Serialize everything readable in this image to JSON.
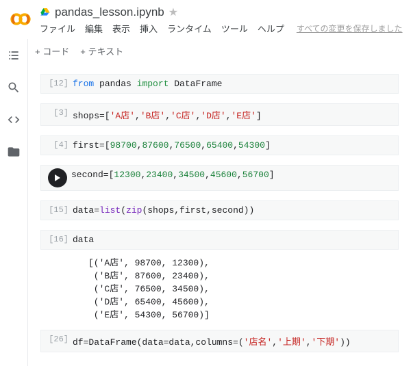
{
  "header": {
    "filename": "pandas_lesson.ipynb",
    "menus": [
      "ファイル",
      "編集",
      "表示",
      "挿入",
      "ランタイム",
      "ツール",
      "ヘルプ"
    ],
    "save_status": "すべての変更を保存しました"
  },
  "toolbar": {
    "code": "コード",
    "text": "テキスト"
  },
  "cells": [
    {
      "n": "[12]",
      "tokens": [
        {
          "t": "from",
          "c": "kw1"
        },
        {
          "t": " pandas ",
          "c": ""
        },
        {
          "t": "import",
          "c": "kw2"
        },
        {
          "t": " DataFrame",
          "c": ""
        }
      ]
    },
    {
      "n": "[3]",
      "tokens": [
        {
          "t": "shops=[",
          "c": ""
        },
        {
          "t": "'A店'",
          "c": "str"
        },
        {
          "t": ",",
          "c": ""
        },
        {
          "t": "'B店'",
          "c": "str"
        },
        {
          "t": ",",
          "c": ""
        },
        {
          "t": "'C店'",
          "c": "str"
        },
        {
          "t": ",",
          "c": ""
        },
        {
          "t": "'D店'",
          "c": "str"
        },
        {
          "t": ",",
          "c": ""
        },
        {
          "t": "'E店'",
          "c": "str"
        },
        {
          "t": "]",
          "c": ""
        }
      ]
    },
    {
      "n": "[4]",
      "tokens": [
        {
          "t": "first=[",
          "c": ""
        },
        {
          "t": "98700",
          "c": "num"
        },
        {
          "t": ",",
          "c": ""
        },
        {
          "t": "87600",
          "c": "num"
        },
        {
          "t": ",",
          "c": ""
        },
        {
          "t": "76500",
          "c": "num"
        },
        {
          "t": ",",
          "c": ""
        },
        {
          "t": "65400",
          "c": "num"
        },
        {
          "t": ",",
          "c": ""
        },
        {
          "t": "54300",
          "c": "num"
        },
        {
          "t": "]",
          "c": ""
        }
      ]
    },
    {
      "n": "",
      "active": true,
      "tokens": [
        {
          "t": "second=[",
          "c": ""
        },
        {
          "t": "12300",
          "c": "num"
        },
        {
          "t": ",",
          "c": ""
        },
        {
          "t": "23400",
          "c": "num"
        },
        {
          "t": ",",
          "c": ""
        },
        {
          "t": "34500",
          "c": "num"
        },
        {
          "t": ",",
          "c": ""
        },
        {
          "t": "45600",
          "c": "num"
        },
        {
          "t": ",",
          "c": ""
        },
        {
          "t": "56700",
          "c": "num"
        },
        {
          "t": "]",
          "c": ""
        }
      ]
    },
    {
      "n": "[15]",
      "tokens": [
        {
          "t": "data=",
          "c": ""
        },
        {
          "t": "list",
          "c": "fn"
        },
        {
          "t": "(",
          "c": ""
        },
        {
          "t": "zip",
          "c": "fn"
        },
        {
          "t": "(shops,first,second))",
          "c": ""
        }
      ]
    },
    {
      "n": "[16]",
      "tokens": [
        {
          "t": "data",
          "c": ""
        }
      ],
      "output": "[('A店', 98700, 12300),\n ('B店', 87600, 23400),\n ('C店', 76500, 34500),\n ('D店', 65400, 45600),\n ('E店', 54300, 56700)]"
    },
    {
      "n": "[26]",
      "tokens": [
        {
          "t": "df=DataFrame(data=data,columns=(",
          "c": ""
        },
        {
          "t": "'店名'",
          "c": "str"
        },
        {
          "t": ",",
          "c": ""
        },
        {
          "t": "'上期'",
          "c": "str"
        },
        {
          "t": ",",
          "c": ""
        },
        {
          "t": "'下期'",
          "c": "str"
        },
        {
          "t": "))",
          "c": ""
        }
      ]
    }
  ]
}
